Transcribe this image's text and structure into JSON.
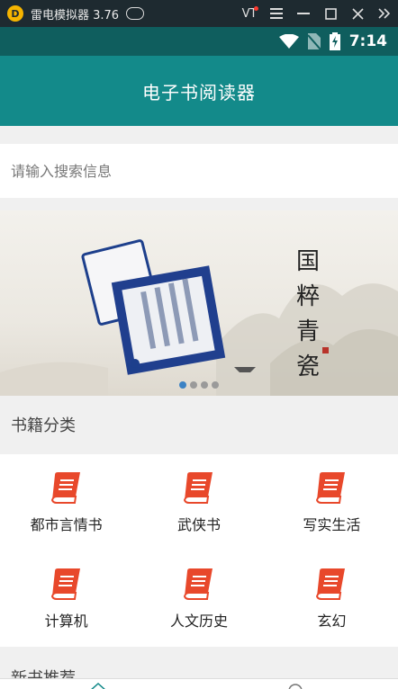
{
  "emulator": {
    "title": "雷电模拟器 3.76",
    "vt_label": "VT"
  },
  "status_bar": {
    "time": "7:14"
  },
  "app_bar": {
    "title": "电子书阅读器"
  },
  "search": {
    "placeholder": "请输入搜索信息",
    "value": ""
  },
  "banner": {
    "slides": 4,
    "active_slide": 1,
    "calligraphy_lines": [
      "国",
      "粹",
      "青",
      "瓷"
    ]
  },
  "categories_section": {
    "title": "书籍分类",
    "items": [
      {
        "label": "都市言情书",
        "icon": "book-icon"
      },
      {
        "label": "武侠书",
        "icon": "book-icon"
      },
      {
        "label": "写实生活",
        "icon": "book-icon"
      },
      {
        "label": "计算机",
        "icon": "book-icon"
      },
      {
        "label": "人文历史",
        "icon": "book-icon"
      },
      {
        "label": "玄幻",
        "icon": "book-icon"
      }
    ]
  },
  "new_books_section": {
    "title": "新书推荐"
  },
  "colors": {
    "app_bar": "#138a8a",
    "status_bar": "#0f5e5e",
    "icon_red": "#e8482b",
    "dot_active": "#3b82c4"
  }
}
